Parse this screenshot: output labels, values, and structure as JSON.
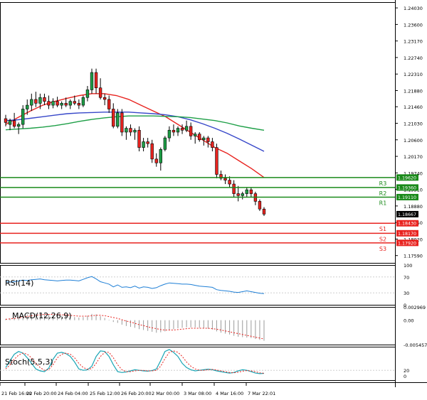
{
  "chart_data": {
    "type": "candlestick",
    "price_axis": {
      "ticks": [
        "1.24030",
        "1.23600",
        "1.23170",
        "1.22740",
        "1.22310",
        "1.21880",
        "1.21460",
        "1.21030",
        "1.20600",
        "1.20170",
        "1.19740",
        "1.19310",
        "1.18880",
        "1.18450",
        "1.18020",
        "1.17590"
      ],
      "ylim": [
        1.174,
        1.2418
      ],
      "current_price": "1.18667"
    },
    "time_axis": {
      "labels": [
        "21 Feb 16:00",
        "22 Feb 20:00",
        "24 Feb 04:00",
        "25 Feb 12:00",
        "26 Feb 20:00",
        "2 Mar 00:00",
        "3 Mar 08:00",
        "4 Mar 16:00",
        "7 Mar 22:01"
      ]
    },
    "candles": [
      {
        "o": 1.2115,
        "h": 1.2125,
        "l": 1.2095,
        "c": 1.2105
      },
      {
        "o": 1.21,
        "h": 1.2115,
        "l": 1.2085,
        "c": 1.211
      },
      {
        "o": 1.211,
        "h": 1.213,
        "l": 1.209,
        "c": 1.2095
      },
      {
        "o": 1.2095,
        "h": 1.2105,
        "l": 1.2075,
        "c": 1.21
      },
      {
        "o": 1.21,
        "h": 1.215,
        "l": 1.209,
        "c": 1.214
      },
      {
        "o": 1.214,
        "h": 1.2165,
        "l": 1.2125,
        "c": 1.215
      },
      {
        "o": 1.215,
        "h": 1.218,
        "l": 1.2135,
        "c": 1.2165
      },
      {
        "o": 1.2165,
        "h": 1.2185,
        "l": 1.2145,
        "c": 1.2155
      },
      {
        "o": 1.2155,
        "h": 1.218,
        "l": 1.214,
        "c": 1.217
      },
      {
        "o": 1.217,
        "h": 1.218,
        "l": 1.215,
        "c": 1.216
      },
      {
        "o": 1.216,
        "h": 1.2175,
        "l": 1.214,
        "c": 1.215
      },
      {
        "o": 1.215,
        "h": 1.2168,
        "l": 1.2142,
        "c": 1.216
      },
      {
        "o": 1.216,
        "h": 1.2172,
        "l": 1.2145,
        "c": 1.215
      },
      {
        "o": 1.215,
        "h": 1.216,
        "l": 1.214,
        "c": 1.2155
      },
      {
        "o": 1.2155,
        "h": 1.217,
        "l": 1.2145,
        "c": 1.215
      },
      {
        "o": 1.215,
        "h": 1.2165,
        "l": 1.214,
        "c": 1.216
      },
      {
        "o": 1.216,
        "h": 1.2175,
        "l": 1.215,
        "c": 1.2155
      },
      {
        "o": 1.2155,
        "h": 1.2165,
        "l": 1.214,
        "c": 1.215
      },
      {
        "o": 1.215,
        "h": 1.2175,
        "l": 1.2145,
        "c": 1.217
      },
      {
        "o": 1.217,
        "h": 1.22,
        "l": 1.216,
        "c": 1.219
      },
      {
        "o": 1.219,
        "h": 1.2245,
        "l": 1.218,
        "c": 1.2235
      },
      {
        "o": 1.2235,
        "h": 1.2245,
        "l": 1.218,
        "c": 1.2195
      },
      {
        "o": 1.2195,
        "h": 1.222,
        "l": 1.2165,
        "c": 1.217
      },
      {
        "o": 1.217,
        "h": 1.218,
        "l": 1.215,
        "c": 1.2165
      },
      {
        "o": 1.2165,
        "h": 1.2175,
        "l": 1.213,
        "c": 1.214
      },
      {
        "o": 1.214,
        "h": 1.2155,
        "l": 1.209,
        "c": 1.2095
      },
      {
        "o": 1.2095,
        "h": 1.214,
        "l": 1.209,
        "c": 1.213
      },
      {
        "o": 1.213,
        "h": 1.214,
        "l": 1.207,
        "c": 1.208
      },
      {
        "o": 1.208,
        "h": 1.2095,
        "l": 1.206,
        "c": 1.209
      },
      {
        "o": 1.209,
        "h": 1.21,
        "l": 1.207,
        "c": 1.208
      },
      {
        "o": 1.208,
        "h": 1.209,
        "l": 1.206,
        "c": 1.2085
      },
      {
        "o": 1.2085,
        "h": 1.2095,
        "l": 1.203,
        "c": 1.204
      },
      {
        "o": 1.204,
        "h": 1.2065,
        "l": 1.203,
        "c": 1.2055
      },
      {
        "o": 1.2055,
        "h": 1.2065,
        "l": 1.204,
        "c": 1.205
      },
      {
        "o": 1.205,
        "h": 1.206,
        "l": 1.2,
        "c": 1.201
      },
      {
        "o": 1.201,
        "h": 1.2025,
        "l": 1.199,
        "c": 1.2
      },
      {
        "o": 1.2,
        "h": 1.204,
        "l": 1.198,
        "c": 1.2035
      },
      {
        "o": 1.2035,
        "h": 1.207,
        "l": 1.203,
        "c": 1.2065
      },
      {
        "o": 1.2065,
        "h": 1.2095,
        "l": 1.2055,
        "c": 1.2085
      },
      {
        "o": 1.2085,
        "h": 1.21,
        "l": 1.207,
        "c": 1.208
      },
      {
        "o": 1.208,
        "h": 1.2095,
        "l": 1.207,
        "c": 1.209
      },
      {
        "o": 1.209,
        "h": 1.21,
        "l": 1.2075,
        "c": 1.2085
      },
      {
        "o": 1.2085,
        "h": 1.211,
        "l": 1.208,
        "c": 1.2095
      },
      {
        "o": 1.2095,
        "h": 1.2105,
        "l": 1.206,
        "c": 1.207
      },
      {
        "o": 1.207,
        "h": 1.208,
        "l": 1.205,
        "c": 1.2075
      },
      {
        "o": 1.2075,
        "h": 1.208,
        "l": 1.2055,
        "c": 1.206
      },
      {
        "o": 1.206,
        "h": 1.207,
        "l": 1.2045,
        "c": 1.2065
      },
      {
        "o": 1.2065,
        "h": 1.207,
        "l": 1.204,
        "c": 1.2055
      },
      {
        "o": 1.2055,
        "h": 1.2065,
        "l": 1.203,
        "c": 1.204
      },
      {
        "o": 1.204,
        "h": 1.205,
        "l": 1.196,
        "c": 1.197
      },
      {
        "o": 1.197,
        "h": 1.198,
        "l": 1.1955,
        "c": 1.196
      },
      {
        "o": 1.196,
        "h": 1.197,
        "l": 1.1945,
        "c": 1.1955
      },
      {
        "o": 1.1955,
        "h": 1.1965,
        "l": 1.1935,
        "c": 1.1945
      },
      {
        "o": 1.1945,
        "h": 1.1955,
        "l": 1.191,
        "c": 1.192
      },
      {
        "o": 1.192,
        "h": 1.194,
        "l": 1.19,
        "c": 1.1915
      },
      {
        "o": 1.1915,
        "h": 1.1925,
        "l": 1.1905,
        "c": 1.192
      },
      {
        "o": 1.192,
        "h": 1.1935,
        "l": 1.191,
        "c": 1.193
      },
      {
        "o": 1.193,
        "h": 1.1935,
        "l": 1.191,
        "c": 1.192
      },
      {
        "o": 1.192,
        "h": 1.1925,
        "l": 1.189,
        "c": 1.19
      },
      {
        "o": 1.19,
        "h": 1.1905,
        "l": 1.1875,
        "c": 1.188
      },
      {
        "o": 1.188,
        "h": 1.1885,
        "l": 1.1862,
        "c": 1.18667
      }
    ],
    "moving_averages": [
      {
        "color": "#e8231f",
        "points": [
          1.21,
          1.2118,
          1.2135,
          1.215,
          1.216,
          1.2168,
          1.2175,
          1.218,
          1.218,
          1.2175,
          1.2165,
          1.215,
          1.2135,
          1.212,
          1.21,
          1.208,
          1.206,
          1.204,
          1.2025,
          1.2005,
          1.1985,
          1.1962
        ]
      },
      {
        "color": "#3747c9",
        "points": [
          1.211,
          1.2112,
          1.2116,
          1.212,
          1.2124,
          1.2128,
          1.213,
          1.2131,
          1.2132,
          1.2132,
          1.2132,
          1.213,
          1.2128,
          1.2125,
          1.212,
          1.2112,
          1.2102,
          1.209,
          1.2077,
          1.2062,
          1.2046,
          1.203
        ]
      },
      {
        "color": "#1e9f47",
        "points": [
          1.2086,
          1.2088,
          1.209,
          1.2093,
          1.2097,
          1.2102,
          1.2108,
          1.2113,
          1.2117,
          1.212,
          1.2122,
          1.2122,
          1.2122,
          1.2121,
          1.212,
          1.2118,
          1.2114,
          1.211,
          1.2104,
          1.2096,
          1.209,
          1.2085
        ]
      }
    ],
    "levels": [
      {
        "label": "R3",
        "price": "1.19620",
        "value": 1.1962,
        "color": "#1a8a1a"
      },
      {
        "label": "R2",
        "price": "1.19360",
        "value": 1.1936,
        "color": "#1a8a1a"
      },
      {
        "label": "R1",
        "price": "1.19110",
        "value": 1.1911,
        "color": "#1a8a1a"
      },
      {
        "label": "S1",
        "price": "1.18430",
        "value": 1.1843,
        "color": "#e8231f"
      },
      {
        "label": "S2",
        "price": "1.18170",
        "value": 1.1817,
        "color": "#e8231f"
      },
      {
        "label": "S3",
        "price": "1.17920",
        "value": 1.1792,
        "color": "#e8231f"
      }
    ],
    "rsi": {
      "title": "RSI(14)",
      "ticks": [
        "100",
        "70",
        "30",
        "0"
      ],
      "ylim": [
        0,
        100
      ],
      "color": "#1e7fd6",
      "values": [
        58,
        57,
        58,
        60,
        62,
        61,
        63,
        64,
        65,
        63,
        62,
        61,
        60,
        61,
        62,
        62,
        61,
        60,
        64,
        68,
        71,
        65,
        58,
        55,
        52,
        45,
        50,
        44,
        45,
        43,
        47,
        42,
        45,
        44,
        41,
        43,
        48,
        52,
        55,
        54,
        53,
        52,
        52,
        51,
        49,
        47,
        46,
        45,
        44,
        38,
        36,
        35,
        34,
        32,
        31,
        33,
        35,
        33,
        31,
        29,
        28
      ]
    },
    "macd": {
      "title": "MACD(12,26,9)",
      "ticks": [
        "0.002969",
        "0.00",
        "-0.005457"
      ],
      "ylim": [
        -0.005457,
        0.002969
      ],
      "hist_color": "#9a9a9a",
      "signal_color": "#e8231f",
      "histogram": [
        0.0003,
        0.0004,
        0.0006,
        0.0008,
        0.0011,
        0.0013,
        0.0014,
        0.0015,
        0.0015,
        0.0014,
        0.0013,
        0.0012,
        0.0011,
        0.001,
        0.0009,
        0.0008,
        0.0007,
        0.0006,
        0.0007,
        0.001,
        0.0014,
        0.0013,
        0.0009,
        0.0005,
        0.0001,
        -0.0004,
        -0.0006,
        -0.001,
        -0.0013,
        -0.0015,
        -0.0017,
        -0.002,
        -0.0022,
        -0.0024,
        -0.0026,
        -0.0028,
        -0.0027,
        -0.0025,
        -0.0022,
        -0.002,
        -0.0018,
        -0.0017,
        -0.0016,
        -0.0016,
        -0.0016,
        -0.0017,
        -0.0018,
        -0.0019,
        -0.0021,
        -0.0025,
        -0.0028,
        -0.003,
        -0.0032,
        -0.0035,
        -0.0037,
        -0.0038,
        -0.0039,
        -0.004,
        -0.0042,
        -0.0044,
        -0.0046
      ],
      "signal": [
        0.0002,
        0.0003,
        0.0004,
        0.0005,
        0.0007,
        0.0008,
        0.001,
        0.0011,
        0.0012,
        0.0013,
        0.0013,
        0.0013,
        0.0013,
        0.0012,
        0.0012,
        0.0011,
        0.001,
        0.0009,
        0.0009,
        0.0009,
        0.001,
        0.0011,
        0.0011,
        0.001,
        0.0008,
        0.0006,
        0.0004,
        0.0001,
        -0.0002,
        -0.0004,
        -0.0007,
        -0.001,
        -0.0012,
        -0.0015,
        -0.0017,
        -0.0019,
        -0.0021,
        -0.0022,
        -0.0022,
        -0.0022,
        -0.0021,
        -0.002,
        -0.0019,
        -0.0018,
        -0.0018,
        -0.0018,
        -0.0018,
        -0.0018,
        -0.0019,
        -0.002,
        -0.0022,
        -0.0024,
        -0.0026,
        -0.0028,
        -0.003,
        -0.0032,
        -0.0034,
        -0.0036,
        -0.0038,
        -0.004,
        -0.0042
      ]
    },
    "stoch": {
      "title": "Stoch(5,5,3)",
      "ticks": [
        "20",
        "0"
      ],
      "ylim": [
        0,
        100
      ],
      "main_color": "#1aa5b5",
      "signal_color": "#e8231f",
      "main": [
        30,
        55,
        78,
        88,
        82,
        65,
        45,
        25,
        18,
        15,
        28,
        60,
        82,
        85,
        80,
        70,
        50,
        25,
        20,
        22,
        35,
        70,
        90,
        88,
        70,
        40,
        15,
        12,
        14,
        18,
        22,
        20,
        18,
        17,
        19,
        25,
        55,
        88,
        95,
        85,
        70,
        45,
        30,
        22,
        18,
        20,
        22,
        24,
        22,
        18,
        15,
        12,
        10,
        12,
        18,
        22,
        20,
        15,
        10,
        8,
        9
      ],
      "signal": [
        25,
        40,
        60,
        75,
        82,
        78,
        65,
        45,
        30,
        20,
        22,
        40,
        65,
        78,
        82,
        78,
        65,
        45,
        30,
        24,
        26,
        45,
        70,
        85,
        85,
        65,
        40,
        22,
        15,
        15,
        18,
        20,
        20,
        18,
        18,
        20,
        35,
        62,
        85,
        90,
        85,
        70,
        50,
        35,
        25,
        20,
        20,
        22,
        23,
        21,
        18,
        15,
        12,
        11,
        13,
        17,
        19,
        18,
        15,
        11,
        9
      ]
    }
  }
}
